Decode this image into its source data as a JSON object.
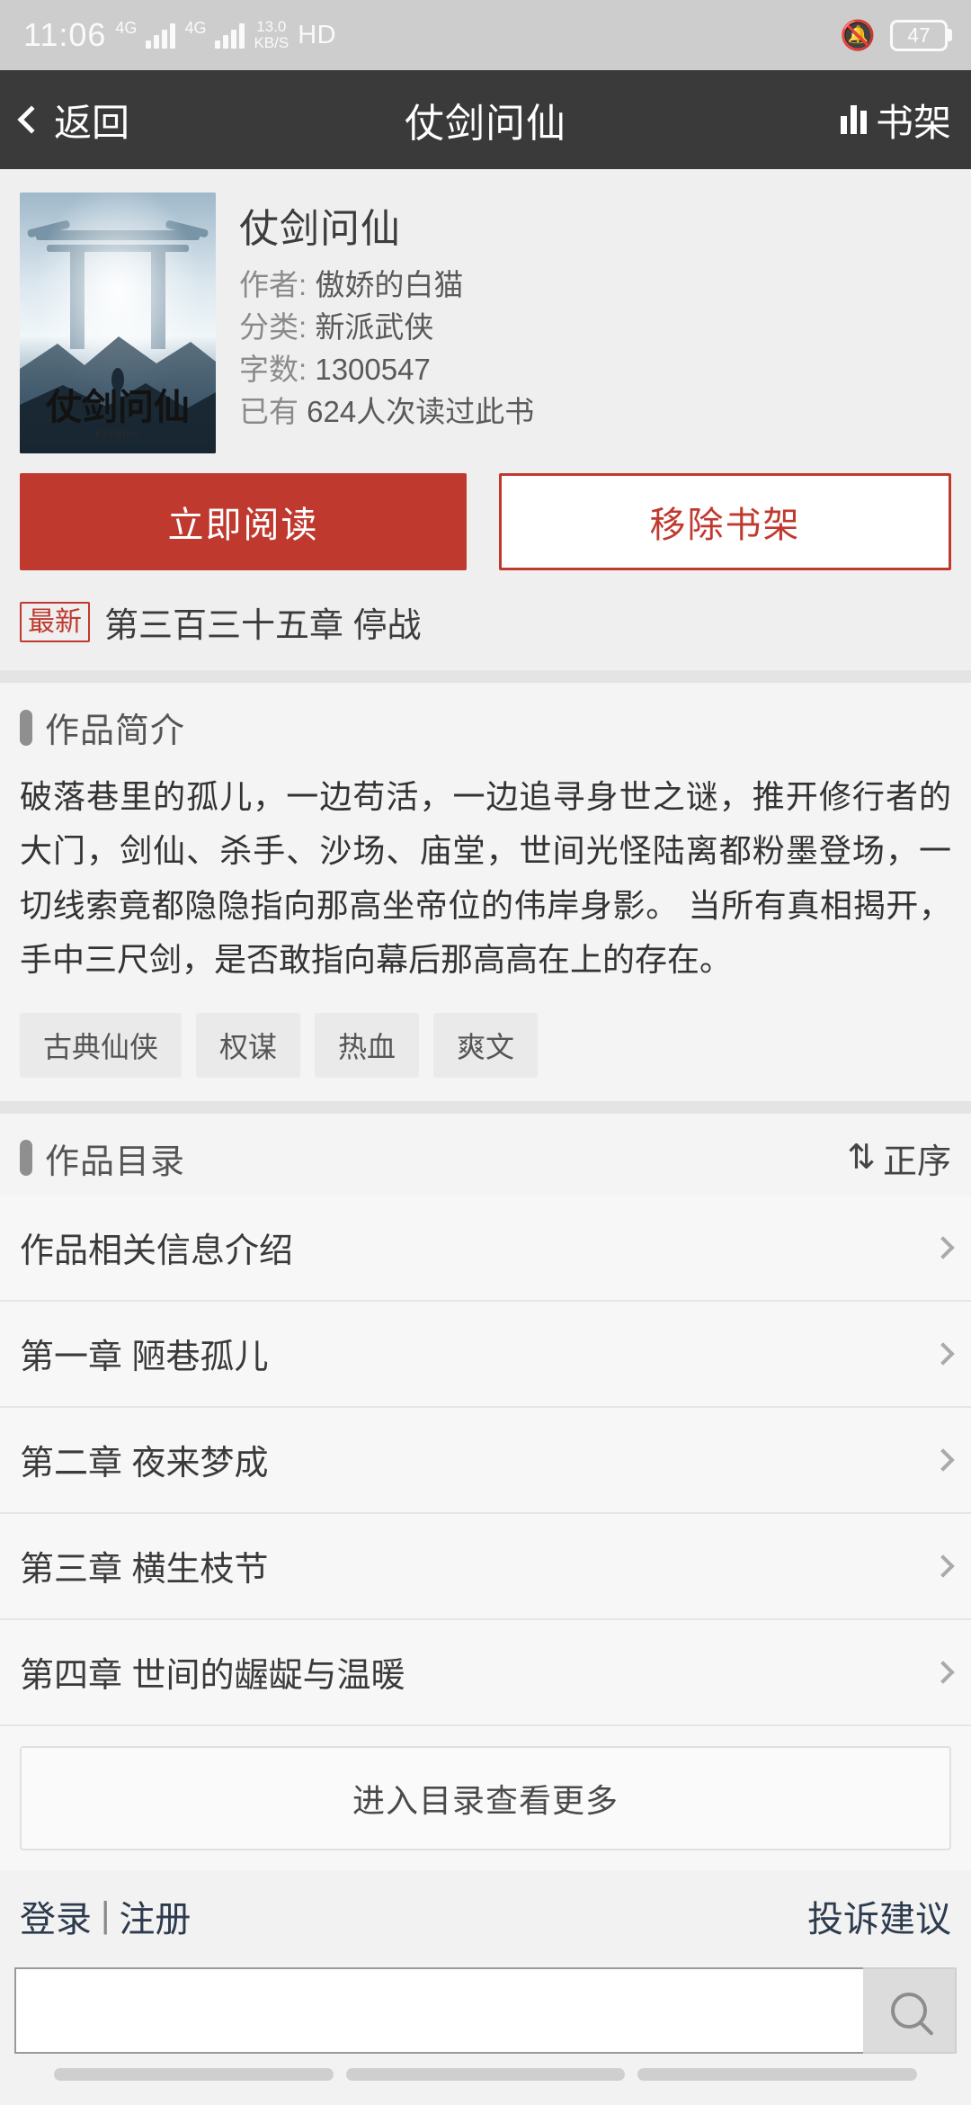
{
  "status_bar": {
    "time": "11:06",
    "network_type_1": "4G",
    "network_type_2": "4G",
    "net_speed_value": "13.0",
    "net_speed_unit": "KB/S",
    "call_mode": "HD",
    "mute_icon": "bell-muted-icon",
    "battery_level": "47"
  },
  "navbar": {
    "back_label": "返回",
    "title": "仗剑问仙",
    "shelf_label": "书架"
  },
  "book": {
    "cover_title": "仗剑问仙",
    "cover_sub": "kakaluo",
    "title": "仗剑问仙",
    "author_label": "作者:",
    "author": "傲娇的白猫",
    "category_label": "分类:",
    "category": "新派武侠",
    "wordcount_label": "字数:",
    "wordcount": "1300547",
    "readers_prefix": "已有",
    "readers_count": "624",
    "readers_suffix": "人次读过此书"
  },
  "actions": {
    "read_now": "立即阅读",
    "remove_shelf": "移除书架",
    "latest_badge": "最新",
    "latest_chapter": "第三百三十五章 停战"
  },
  "intro": {
    "heading": "作品简介",
    "text": "破落巷里的孤儿，一边苟活，一边追寻身世之谜，推开修行者的大门，剑仙、杀手、沙场、庙堂，世间光怪陆离都粉墨登场，一切线索竟都隐隐指向那高坐帝位的伟岸身影。 当所有真相揭开，手中三尺剑，是否敢指向幕后那高高在上的存在。",
    "tags": [
      "古典仙侠",
      "权谋",
      "热血",
      "爽文"
    ]
  },
  "catalog": {
    "heading": "作品目录",
    "sort_label": "正序",
    "sort_icon": "sort-updown-icon",
    "items": [
      "作品相关信息介绍",
      "第一章 陋巷孤儿",
      "第二章 夜来梦成",
      "第三章 横生枝节",
      "第四章 世间的龌龊与温暖"
    ],
    "more_label": "进入目录查看更多"
  },
  "footer": {
    "login": "登录",
    "separator": "|",
    "register": "注册",
    "feedback": "投诉建议"
  },
  "search": {
    "value": "",
    "placeholder": "",
    "icon": "search-icon"
  }
}
